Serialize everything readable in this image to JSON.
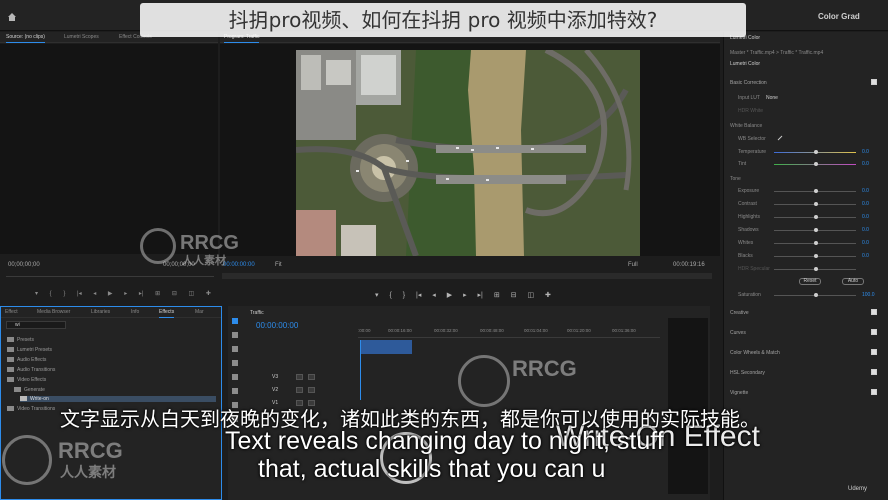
{
  "overlay": {
    "title": "抖抈pro视频、如何在抖抈 pro 视频中添加特效?"
  },
  "topbar": {
    "workspace": "Color Grad"
  },
  "source_panel": {
    "tabs": [
      "Source: (no clips)",
      "Lumetri Scopes",
      "Effect Controls"
    ],
    "timecode_in": "00;00;00;00",
    "timecode_out": "00;00;00;00"
  },
  "program_panel": {
    "tab": "Program: Traffic",
    "timecode_in": "00:00:00:00",
    "fit": "Fit",
    "quality": "Full",
    "timecode_out": "00:00:19:16"
  },
  "lumetri": {
    "header": "Lumetri Color",
    "breadcrumb": "Master * Traffic.mp4  >  Traffic * Traffic.mp4",
    "preset": "Lumetri Color",
    "basic_correction": "Basic Correction",
    "input_lut_label": "Input LUT",
    "input_lut_value": "None",
    "hdr_white": "HDR White",
    "white_balance": "White Balance",
    "wb_selector": "WB Selector",
    "temperature": "Temperature",
    "tint": "Tint",
    "tone": "Tone",
    "tone_sliders": [
      "Exposure",
      "Contrast",
      "Highlights",
      "Shadows",
      "Whites",
      "Blacks",
      "HDR Specular"
    ],
    "reset": "Reset",
    "auto": "Auto",
    "saturation": "Saturation",
    "sections": [
      "Creative",
      "Curves",
      "Color Wheels & Match",
      "HSL Secondary",
      "Vignette"
    ],
    "temp_value": "0.0",
    "tint_value": "0.0",
    "tone_values": [
      "0.0",
      "0.0",
      "0.0",
      "0.0",
      "0.0",
      "0.0",
      ""
    ],
    "sat_value": "100.0"
  },
  "effects_panel": {
    "tabs": [
      "Effect",
      "Media Browser",
      "Libraries",
      "Info",
      "Effects",
      "Mar"
    ],
    "search": "wi",
    "tree": [
      "Presets",
      "Lumetri Presets",
      "Audio Effects",
      "Audio Transitions",
      "Video Effects",
      "Generate",
      "Write-on",
      "Video Transitions"
    ]
  },
  "timeline": {
    "tab": "Traffic",
    "timecode": "00:00:00:00",
    "ruler": [
      ":00:00",
      "00:00:16:00",
      "00:00:32:00",
      "00:00:48:00",
      "00:01:04:00",
      "00:01:20:00",
      "00:01:36:00"
    ],
    "track_labels": [
      "V3",
      "V2",
      "V1",
      "A1",
      "A2",
      "A3"
    ]
  },
  "subtitles": {
    "chinese": "文字显示从白天到夜晚的变化，诸如此类的东西，都是你可以使用的实际技能。",
    "english_line1": "Text reveals changing day to night, stuff",
    "english_line2": "that, actual skills            that you can u",
    "effect_title": "Write-On Effect"
  },
  "watermarks": {
    "rrcg": "RRCG",
    "rrcg_cn": "人人素材",
    "udemy": "Udemy"
  }
}
